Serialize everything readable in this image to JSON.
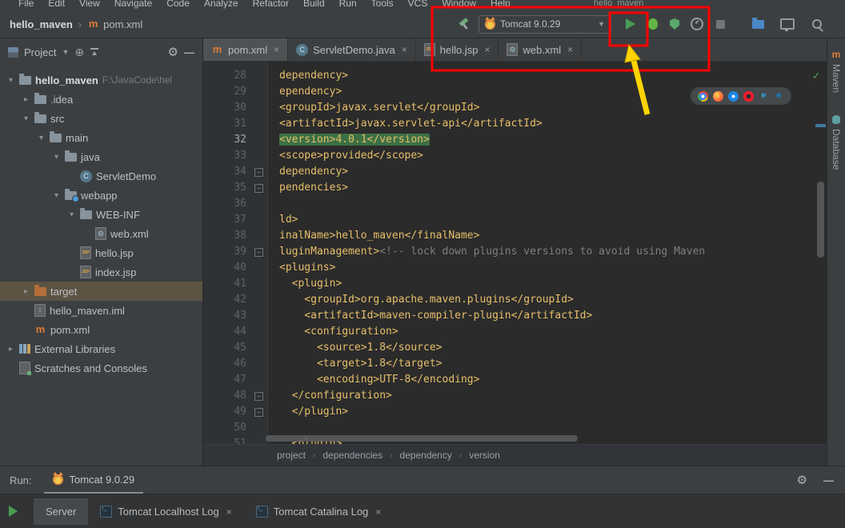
{
  "window": {
    "title": "hello_maven"
  },
  "menu_bar": {
    "items": [
      "File",
      "Edit",
      "View",
      "Navigate",
      "Code",
      "Analyze",
      "Refactor",
      "Build",
      "Run",
      "Tools",
      "VCS",
      "Window",
      "Help"
    ]
  },
  "nav_breadcrumb": {
    "project": "hello_maven",
    "separator": "›",
    "file": "pom.xml"
  },
  "toolbar": {
    "run_config": "Tomcat 9.0.29"
  },
  "project_panel": {
    "title": "Project",
    "items": [
      {
        "label": "hello_maven",
        "hint": "F:\\JavaCode\\hel",
        "level": 0,
        "arrow": "open",
        "icon": "folder",
        "bold": true
      },
      {
        "label": ".idea",
        "level": 1,
        "arrow": "closed",
        "icon": "folder"
      },
      {
        "label": "src",
        "level": 1,
        "arrow": "open",
        "icon": "folder"
      },
      {
        "label": "main",
        "level": 2,
        "arrow": "open",
        "icon": "folder"
      },
      {
        "label": "java",
        "level": 3,
        "arrow": "open",
        "icon": "folder"
      },
      {
        "label": "ServletDemo",
        "level": 4,
        "arrow": "none",
        "icon": "class"
      },
      {
        "label": "webapp",
        "level": 3,
        "arrow": "open",
        "icon": "webfolder"
      },
      {
        "label": "WEB-INF",
        "level": 4,
        "arrow": "open",
        "icon": "folder"
      },
      {
        "label": "web.xml",
        "level": 5,
        "arrow": "none",
        "icon": "webxml"
      },
      {
        "label": "hello.jsp",
        "level": 4,
        "arrow": "none",
        "icon": "jsp"
      },
      {
        "label": "index.jsp",
        "level": 4,
        "arrow": "none",
        "icon": "jsp"
      },
      {
        "label": "target",
        "level": 1,
        "arrow": "closed",
        "icon": "folder-excluded",
        "selected": true
      },
      {
        "label": "hello_maven.iml",
        "level": 1,
        "arrow": "none",
        "icon": "iml"
      },
      {
        "label": "pom.xml",
        "level": 1,
        "arrow": "none",
        "icon": "maven"
      },
      {
        "label": "External Libraries",
        "level": 0,
        "arrow": "closed",
        "icon": "libs"
      },
      {
        "label": "Scratches and Consoles",
        "level": 0,
        "arrow": "none",
        "icon": "scratch"
      }
    ]
  },
  "editor": {
    "tabs": [
      {
        "label": "pom.xml",
        "icon": "maven",
        "active": true
      },
      {
        "label": "ServletDemo.java",
        "icon": "class",
        "active": false
      },
      {
        "label": "hello.jsp",
        "icon": "jsp",
        "active": false
      },
      {
        "label": "web.xml",
        "icon": "webxml",
        "active": false
      }
    ],
    "lines": [
      {
        "num": 28,
        "segs": [
          [
            "dependency>",
            "tag"
          ]
        ]
      },
      {
        "num": 29,
        "segs": [
          [
            "ependency>",
            "tag"
          ]
        ]
      },
      {
        "num": 30,
        "segs": [
          [
            "<groupId>javax.servlet</groupId>",
            "tag"
          ]
        ]
      },
      {
        "num": 31,
        "segs": [
          [
            "<artifactId>javax.servlet-api</artifactId>",
            "tag"
          ]
        ]
      },
      {
        "num": 32,
        "caret": true,
        "segs": [
          [
            "<version>4.0.1</version>",
            "tag hl"
          ]
        ]
      },
      {
        "num": 33,
        "segs": [
          [
            "<scope>provided</scope>",
            "tag"
          ]
        ]
      },
      {
        "num": 34,
        "fold": true,
        "segs": [
          [
            "dependency>",
            "tag"
          ]
        ]
      },
      {
        "num": 35,
        "fold": true,
        "segs": [
          [
            "pendencies>",
            "tag"
          ]
        ]
      },
      {
        "num": 36,
        "segs": []
      },
      {
        "num": 37,
        "segs": [
          [
            "ld>",
            "tag"
          ]
        ]
      },
      {
        "num": 38,
        "segs": [
          [
            "inalName>hello_maven</finalName>",
            "tag"
          ]
        ]
      },
      {
        "num": 39,
        "fold": true,
        "segs": [
          [
            "luginManagement>",
            "tag"
          ],
          [
            "<!-- lock down plugins versions to avoid using Maven",
            "comment"
          ]
        ]
      },
      {
        "num": 40,
        "segs": [
          [
            "<plugins>",
            "tag"
          ]
        ]
      },
      {
        "num": 41,
        "segs": [
          [
            "  <plugin>",
            "tag"
          ]
        ]
      },
      {
        "num": 42,
        "segs": [
          [
            "    <groupId>org.apache.maven.plugins</groupId>",
            "tag"
          ]
        ]
      },
      {
        "num": 43,
        "segs": [
          [
            "    <artifactId>maven-compiler-plugin</artifactId>",
            "tag"
          ]
        ]
      },
      {
        "num": 44,
        "segs": [
          [
            "    <configuration>",
            "tag"
          ]
        ]
      },
      {
        "num": 45,
        "segs": [
          [
            "      <source>1.8</source>",
            "tag"
          ]
        ]
      },
      {
        "num": 46,
        "segs": [
          [
            "      <target>1.8</target>",
            "tag"
          ]
        ]
      },
      {
        "num": 47,
        "segs": [
          [
            "      <encoding>UTF-8</encoding>",
            "tag"
          ]
        ]
      },
      {
        "num": 48,
        "fold": true,
        "segs": [
          [
            "  </configuration>",
            "tag"
          ]
        ]
      },
      {
        "num": 49,
        "fold": true,
        "segs": [
          [
            "  </plugin>",
            "tag"
          ]
        ]
      },
      {
        "num": 50,
        "segs": []
      },
      {
        "num": 51,
        "segs": [
          [
            "  <plugin>",
            "tag"
          ]
        ]
      }
    ],
    "breadcrumb_separator": "›",
    "breadcrumbs": [
      "project",
      "dependencies",
      "dependency",
      "version"
    ]
  },
  "browsers": [
    "chrome",
    "firefox",
    "safari",
    "opera",
    "ie",
    "edge"
  ],
  "right_stripe": {
    "tabs": [
      "Maven",
      "Database"
    ]
  },
  "run_panel": {
    "label": "Run:",
    "tab": "Tomcat 9.0.29"
  },
  "bottom_bar": {
    "tabs": [
      {
        "label": "Server",
        "icon": "none",
        "active": true,
        "closable": false
      },
      {
        "label": "Tomcat Localhost Log",
        "icon": "console",
        "active": false,
        "closable": true
      },
      {
        "label": "Tomcat Catalina Log",
        "icon": "console",
        "active": false,
        "closable": true
      }
    ]
  },
  "colors": {
    "annotation_red": "#fe0000",
    "annotation_yellow": "#ffd400",
    "run_green": "#499c54",
    "version_highlight_green": "#3c7044"
  }
}
